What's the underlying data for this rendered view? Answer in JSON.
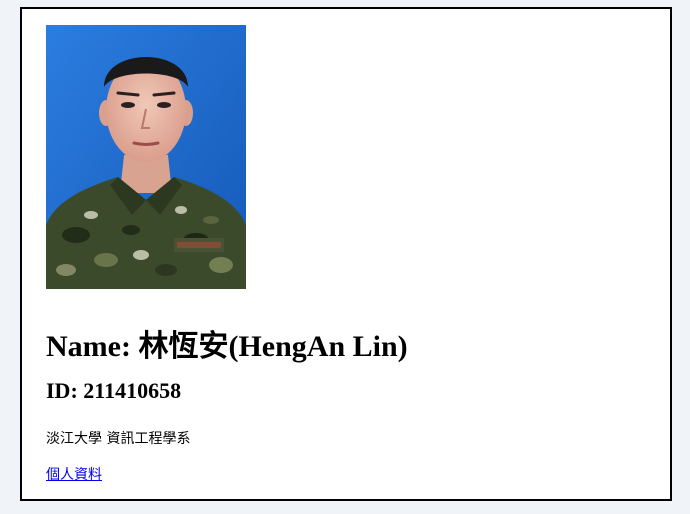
{
  "profile": {
    "name_label": "Name:",
    "name_value": "林恆安(HengAn Lin)",
    "id_label": "ID:",
    "id_value": "211410658",
    "department": "淡江大學 資訊工程學系",
    "link_text": "個人資料"
  },
  "photo": {
    "alt": "Portrait photo",
    "background_color": "#1f6fd6",
    "uniform_color": "#3a4a2c"
  }
}
